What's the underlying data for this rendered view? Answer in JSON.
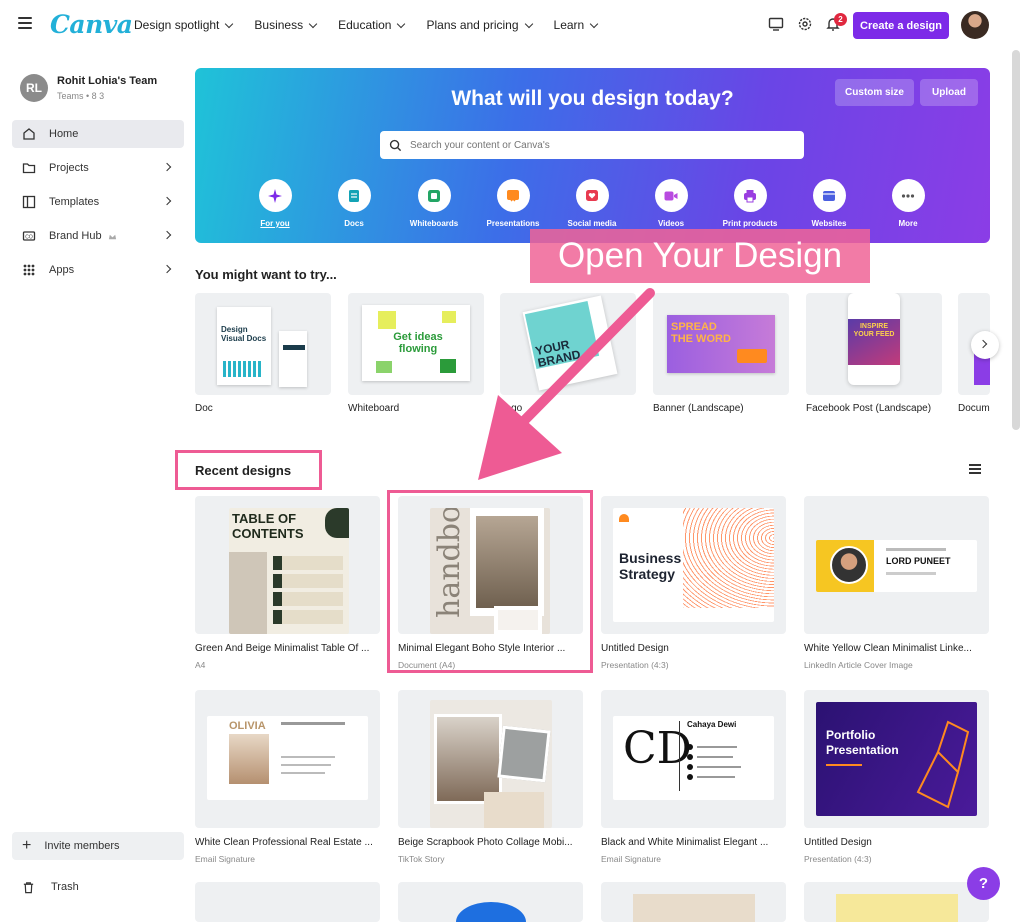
{
  "topbar": {
    "logo": "Canva",
    "nav": [
      {
        "label": "Design spotlight"
      },
      {
        "label": "Business"
      },
      {
        "label": "Education"
      },
      {
        "label": "Plans and pricing"
      },
      {
        "label": "Learn"
      }
    ],
    "notification_count": "2",
    "create_label": "Create a design"
  },
  "sidebar": {
    "team_initials": "RL",
    "team_name": "Rohit Lohia's Team",
    "team_sub": "Teams • 8 3",
    "items": [
      {
        "label": "Home",
        "icon": "home-icon"
      },
      {
        "label": "Projects",
        "icon": "folder-icon"
      },
      {
        "label": "Templates",
        "icon": "templates-icon"
      },
      {
        "label": "Brand Hub",
        "icon": "brand-icon"
      },
      {
        "label": "Apps",
        "icon": "apps-icon"
      }
    ],
    "invite_label": "Invite members",
    "trash_label": "Trash"
  },
  "hero": {
    "title": "What will you design today?",
    "custom_size": "Custom size",
    "upload": "Upload",
    "search_placeholder": "Search your content or Canva's",
    "categories": [
      {
        "label": "For you",
        "color": "#7d2ae8"
      },
      {
        "label": "Docs",
        "color": "#13a3b5"
      },
      {
        "label": "Whiteboards",
        "color": "#23a565"
      },
      {
        "label": "Presentations",
        "color": "#ff8a1f"
      },
      {
        "label": "Social media",
        "color": "#e83a4f"
      },
      {
        "label": "Videos",
        "color": "#b84be0"
      },
      {
        "label": "Print products",
        "color": "#9a3de0"
      },
      {
        "label": "Websites",
        "color": "#4b5fe0"
      },
      {
        "label": "More",
        "color": "#555555"
      }
    ]
  },
  "try": {
    "title": "You might want to try...",
    "items": [
      {
        "label": "Doc"
      },
      {
        "label": "Whiteboard"
      },
      {
        "label": "Logo"
      },
      {
        "label": "Banner (Landscape)"
      },
      {
        "label": "Facebook Post (Landscape)"
      },
      {
        "label": "Docum"
      }
    ]
  },
  "overlay": "Open Your Design",
  "recent": {
    "title": "Recent designs",
    "designs": [
      {
        "title": "Green And Beige Minimalist Table Of ...",
        "sub": "A4"
      },
      {
        "title": "Minimal Elegant Boho Style Interior ...",
        "sub": "Document (A4)"
      },
      {
        "title": "Untitled Design",
        "sub": "Presentation (4:3)"
      },
      {
        "title": "White Yellow Clean Minimalist Linke...",
        "sub": "LinkedIn Article Cover Image"
      },
      {
        "title": "White Clean Professional Real Estate ...",
        "sub": "Email Signature"
      },
      {
        "title": "Beige Scrapbook Photo Collage Mobi...",
        "sub": "TikTok Story"
      },
      {
        "title": "Black and White Minimalist Elegant ...",
        "sub": "Email Signature"
      },
      {
        "title": "Untitled Design",
        "sub": "Presentation (4:3)"
      }
    ]
  },
  "thumbs": {
    "toc_title": "TABLE OF CONTENTS",
    "bs_title": "Business Strategy",
    "lord": "LORD PUNEET",
    "olivia": "OLIVIA",
    "cahaya": "Cahaya Dewi",
    "portfolio": "Portfolio Presentation",
    "doc_card": "Design Visual Docs",
    "wb_card": "Get ideas flowing",
    "logo_card": "YOUR BRAND",
    "banner_card": "SPREAD THE WORD",
    "fb_card": "INSPIRE YOUR FEED",
    "handbook": "handbook"
  },
  "help": "?"
}
